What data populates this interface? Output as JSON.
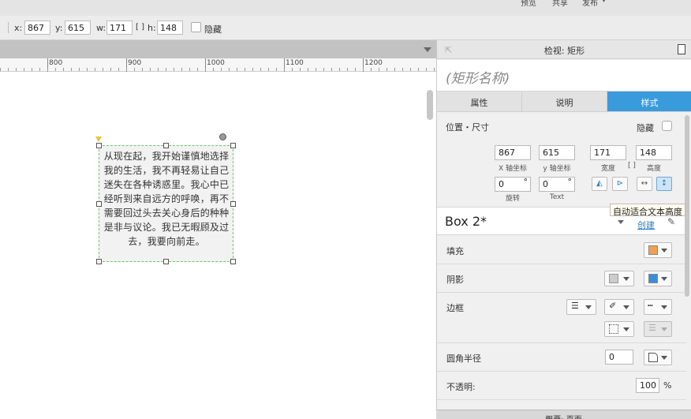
{
  "top_menu": {
    "preview": "预览",
    "share": "共享",
    "publish": "发布"
  },
  "toolbar": {
    "x_label": "x:",
    "x_value": "867",
    "y_label": "y:",
    "y_value": "615",
    "w_label": "w:",
    "w_value": "171",
    "h_label": "h:",
    "h_value": "148",
    "hide_label": "隐藏"
  },
  "ruler": {
    "ticks": [
      "800",
      "900",
      "1000",
      "1100",
      "1200"
    ]
  },
  "canvas": {
    "box_text": "从现在起，我开始谨慎地选择我的生活，我不再轻易让自己迷失在各种诱惑里。我心中已经听到来自远方的呼唤，再不需要回过头去关心身后的种种是非与议论。我已无暇顾及过去，我要向前走。"
  },
  "panel": {
    "header_title": "检视: 矩形",
    "shape_name_placeholder": "(矩形名称)",
    "tabs": [
      {
        "label": "属性",
        "active": false
      },
      {
        "label": "说明",
        "active": false
      },
      {
        "label": "样式",
        "active": true
      }
    ],
    "position_section": {
      "title": "位置・尺寸",
      "hide_label": "隐藏",
      "x": "867",
      "x_label": "X 轴坐标",
      "y": "615",
      "y_label": "y 轴坐标",
      "w": "171",
      "w_label": "宽度",
      "h": "148",
      "h_label": "高度",
      "rotation": "0",
      "rotation_unit": "°",
      "rotation_label": "旋转",
      "text_rotation": "0",
      "text_rotation_unit": "°",
      "text_rotation_label": "Text"
    },
    "style": {
      "name": "Box 2*",
      "create_link": "创建"
    },
    "rows": {
      "fill": "填充",
      "shadow": "阴影",
      "border": "边框",
      "corner_radius": "圆角半径",
      "corner_radius_value": "0",
      "opacity": "不透明:",
      "opacity_value": "100",
      "opacity_unit": "%"
    },
    "colors": {
      "fill": "#f0a050",
      "shadow_color": "#3a8fd6",
      "accent": "#3a9bdc"
    },
    "bottom_title": "概要: 页面"
  },
  "tooltip": "自动适合文本高度"
}
